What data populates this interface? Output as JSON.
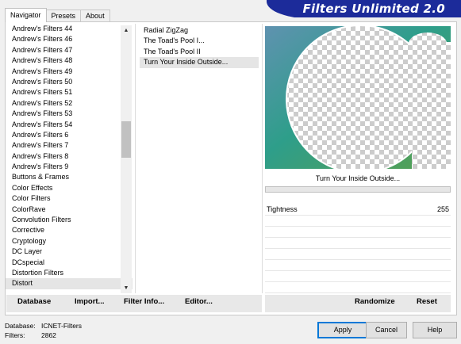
{
  "tabs": [
    {
      "label": "Navigator",
      "active": true
    },
    {
      "label": "Presets",
      "active": false
    },
    {
      "label": "About",
      "active": false
    }
  ],
  "banner": {
    "title": "Filters Unlimited 2.0"
  },
  "categories": [
    "Andrew's Filters 44",
    "Andrew's Filters 46",
    "Andrew's Filters 47",
    "Andrew's Filters 48",
    "Andrew's Filters 49",
    "Andrew's Filters 50",
    "Andrew's Filters 51",
    "Andrew's Filters 52",
    "Andrew's Filters 53",
    "Andrew's Filters 54",
    "Andrew's Filters 6",
    "Andrew's Filters 7",
    "Andrew's Filters 8",
    "Andrew's Filters 9",
    "Buttons & Frames",
    "Color Effects",
    "Color Filters",
    "ColorRave",
    "Convolution Filters",
    "Corrective",
    "Cryptology",
    "DC Layer",
    "DCspecial",
    "Distortion Filters",
    "Distort"
  ],
  "selected_category": "Distort",
  "filters": [
    "Radial ZigZag",
    "The Toad's Pool I...",
    "The Toad's Pool II",
    "Turn Your Inside Outside..."
  ],
  "selected_filter": "Turn Your Inside Outside...",
  "preview": {
    "caption": "Turn Your Inside Outside..."
  },
  "params": [
    {
      "name": "Tightness",
      "value": "255"
    }
  ],
  "buttons": {
    "database": "Database",
    "import": "Import...",
    "filter_info": "Filter Info...",
    "editor": "Editor...",
    "randomize": "Randomize",
    "reset": "Reset",
    "apply": "Apply",
    "cancel": "Cancel",
    "help": "Help"
  },
  "status": {
    "database_label": "Database:",
    "database_value": "ICNET-Filters",
    "filters_label": "Filters:",
    "filters_value": "2862"
  },
  "scroll": {
    "up_icon": "▲",
    "down_icon": "▼"
  }
}
